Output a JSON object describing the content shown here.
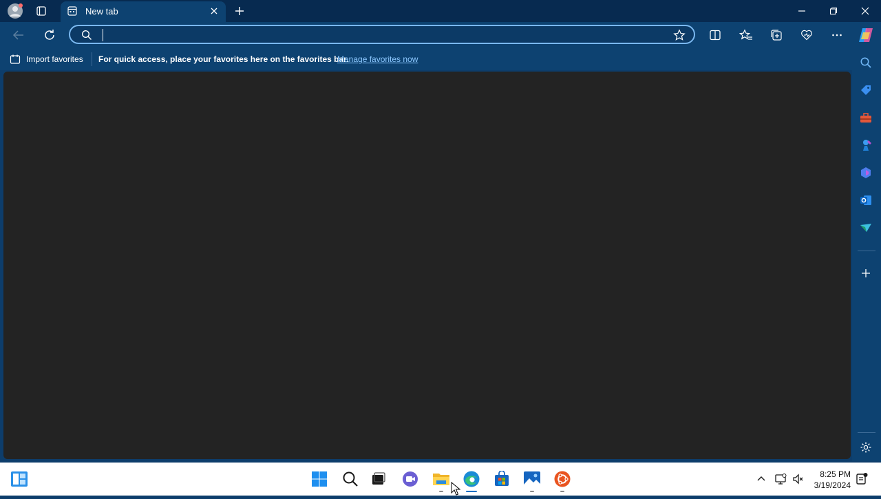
{
  "browser": {
    "tab": {
      "title": "New tab"
    },
    "address": {
      "value": "",
      "placeholder": ""
    },
    "favorites_bar": {
      "import_label": "Import favorites",
      "hint": "For quick access, place your favorites here on the favorites bar.",
      "manage_link": "Manage favorites now"
    },
    "colors": {
      "accent": "#0d4271",
      "titlebar": "#072a50",
      "content": "#232323",
      "link": "#8cc8ff"
    }
  },
  "sidebar": {
    "icons": [
      "search-icon",
      "shopping-tag-icon",
      "toolbox-icon",
      "games-icon",
      "copilot-icon",
      "outlook-icon",
      "send-icon",
      "add-icon",
      "settings-icon"
    ]
  },
  "taskbar": {
    "apps": [
      "start-icon",
      "search-icon",
      "task-view-icon",
      "teams-icon",
      "file-explorer-icon",
      "edge-icon",
      "store-icon",
      "photos-icon",
      "ubuntu-icon"
    ],
    "clock": {
      "time": "8:25 PM",
      "date": "3/19/2024"
    }
  }
}
